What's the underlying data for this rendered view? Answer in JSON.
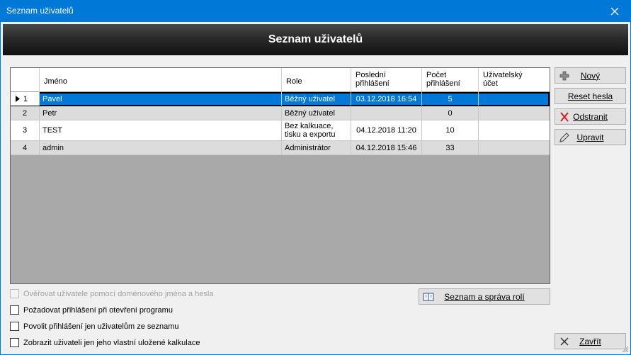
{
  "window": {
    "title": "Seznam uživatelů"
  },
  "header": {
    "title": "Seznam uživatelů"
  },
  "grid": {
    "columns": [
      {
        "id": "jmeno",
        "label": "Jméno"
      },
      {
        "id": "role",
        "label": "Role"
      },
      {
        "id": "posledni",
        "label": "Poslední přihlášení"
      },
      {
        "id": "pocet",
        "label": "Počet přihlášení"
      },
      {
        "id": "ucet",
        "label": "Uživatelský účet"
      }
    ],
    "rows": [
      {
        "num": "1",
        "jmeno": "Pavel",
        "role": "Běžný uživatel",
        "posledni": "03.12.2018 16:54",
        "pocet": "5",
        "ucet": "",
        "selected": true
      },
      {
        "num": "2",
        "jmeno": "Petr",
        "role": "Běžný uživatel",
        "posledni": "",
        "pocet": "0",
        "ucet": ""
      },
      {
        "num": "3",
        "jmeno": "TEST",
        "role": "Bez kalkuace, tisku a exportu",
        "posledni": "04.12.2018 11:20",
        "pocet": "10",
        "ucet": ""
      },
      {
        "num": "4",
        "jmeno": "admin",
        "role": "Administrátor",
        "posledni": "04.12.2018 15:46",
        "pocet": "33",
        "ucet": ""
      }
    ]
  },
  "buttons": {
    "novy": "Nový",
    "reset": "Reset hesla",
    "odstranit": "Odstranit",
    "upravit": "Upravit",
    "role": "Seznam a správa rolí",
    "zavrit": "Zavřít"
  },
  "checkboxes": [
    {
      "label": "Ověřovat uživatele pomocí doménového jména a hesla",
      "checked": false,
      "disabled": true
    },
    {
      "label": "Požadovat přihlášení při otevření programu",
      "checked": false,
      "disabled": false
    },
    {
      "label": "Povolit přihlášení jen uživatelům ze seznamu",
      "checked": false,
      "disabled": false
    },
    {
      "label": "Zobrazit uživateli jen jeho vlastní uložené kalkulace",
      "checked": false,
      "disabled": false
    }
  ],
  "icons": {
    "close": "close-icon",
    "add": "plus-icon",
    "delete": "red-x-icon",
    "edit": "pencil-icon",
    "book": "book-icon",
    "exit": "x-icon",
    "row_pointer": "triangle-right-icon"
  },
  "colors": {
    "titlebar": "#0078d7",
    "selection": "#0078d7",
    "grid_bg": "#a9a9a9",
    "alt_row": "#dcdcdc"
  }
}
